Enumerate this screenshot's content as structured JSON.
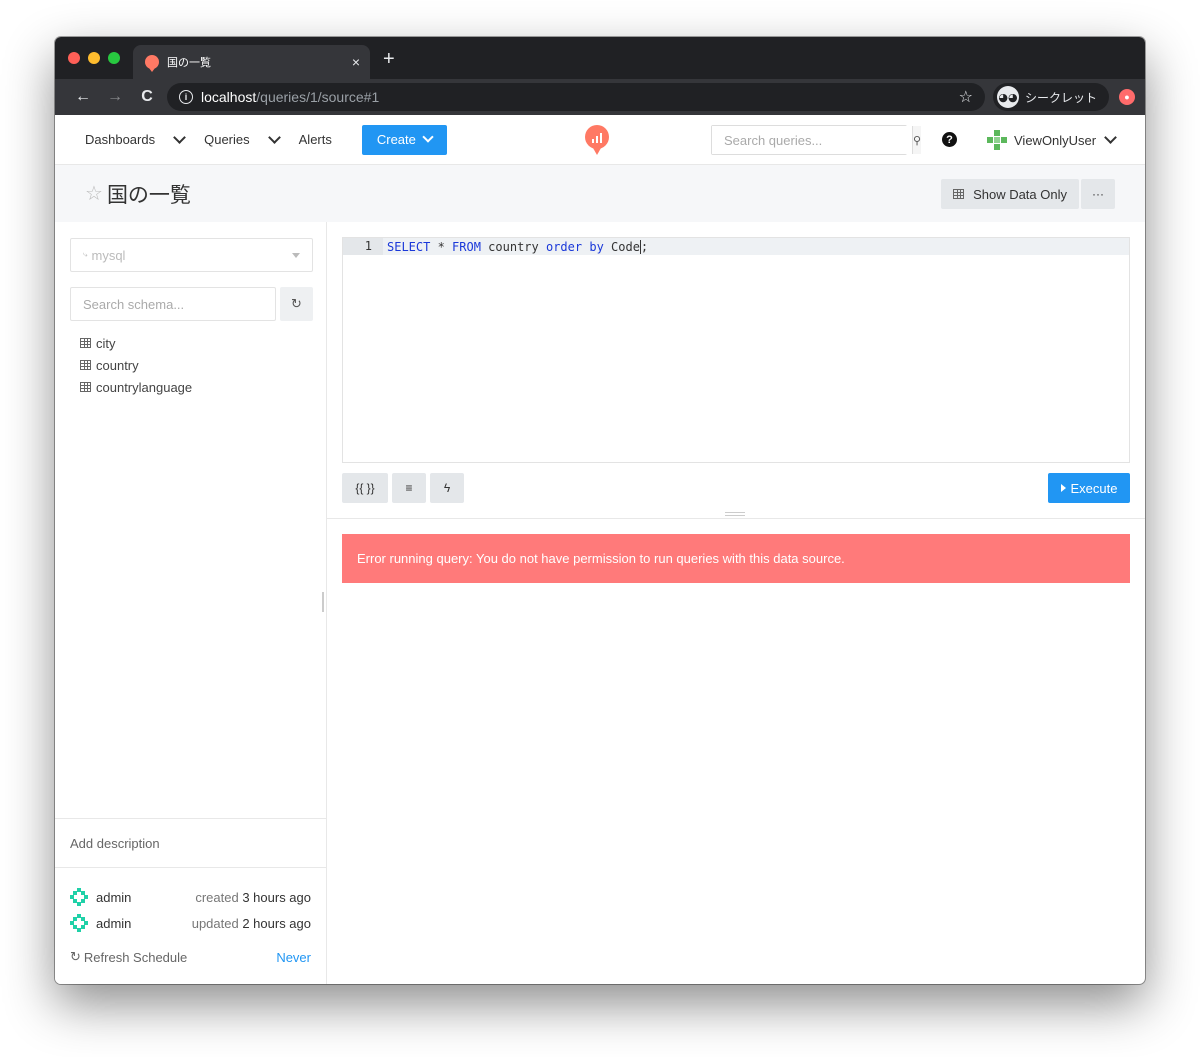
{
  "browser": {
    "tab_title": "国の一覧",
    "tab_close": "×",
    "new_tab": "+",
    "url_host": "localhost",
    "url_path": "/queries/1/source#1",
    "incognito_label": "シークレット"
  },
  "header": {
    "nav": [
      {
        "label": "Dashboards"
      },
      {
        "label": "Queries"
      },
      {
        "label": "Alerts"
      }
    ],
    "create_label": "Create",
    "search_placeholder": "Search queries...",
    "user_name": "ViewOnlyUser",
    "accent_color": "#2196f3",
    "logo_color": "#ff7964"
  },
  "page": {
    "star": "☆",
    "title": "国の一覧",
    "show_data_only_label": "Show Data Only",
    "more_label": "···"
  },
  "sidebar": {
    "data_source": "mysql",
    "schema_search_placeholder": "Search schema...",
    "tables": [
      "city",
      "country",
      "countrylanguage"
    ],
    "add_description": "Add description",
    "meta": [
      {
        "user": "admin",
        "action": "created",
        "time": "3 hours ago"
      },
      {
        "user": "admin",
        "action": "updated",
        "time": "2 hours ago"
      }
    ],
    "refresh_schedule_label": "Refresh Schedule",
    "refresh_schedule_value": "Never"
  },
  "editor": {
    "line_number": "1",
    "tokens": {
      "select": "SELECT",
      "star": " * ",
      "from": "FROM",
      "table": " country ",
      "order": "order",
      "space": " ",
      "by": "by",
      "column": " Code",
      "end": ";"
    },
    "tools": [
      "{{ }}",
      "≡",
      "ϟ"
    ],
    "execute_label": "Execute"
  },
  "error": {
    "message": "Error running query: You do not have permission to run queries with this data source.",
    "color": "#ff7a7a"
  }
}
